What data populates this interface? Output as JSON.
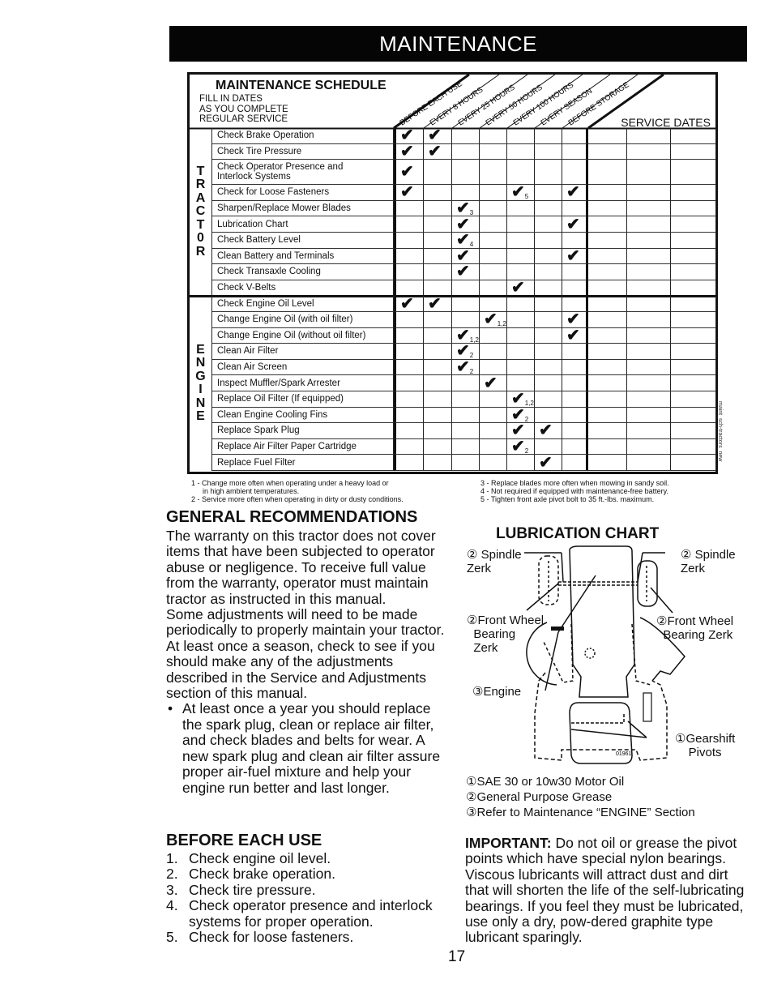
{
  "banner": {
    "title": "MAINTENANCE"
  },
  "schedule": {
    "title": "MAINTENANCE SCHEDULE",
    "subtitle_lines": [
      "FILL IN DATES",
      "AS YOU COMPLETE",
      "REGULAR SERVICE"
    ],
    "interval_headers": [
      "BEFORE EACH USE",
      "EVERY 8 HOURS",
      "EVERY 25 HOURS",
      "EVERY 50 HOURS",
      "EVERY 100 HOURS",
      "EVERY SEASON",
      "BEFORE STORAGE"
    ],
    "service_dates_label": "SERVICE DATES",
    "check_symbol": "✔",
    "sections": [
      {
        "name": "TRACTOR",
        "letters": [
          "T",
          "R",
          "A",
          "C",
          "T",
          "0",
          "R"
        ],
        "rows": [
          {
            "task": "Check Brake Operation",
            "checks": [
              {
                "col": 0,
                "note": ""
              },
              {
                "col": 1,
                "note": ""
              }
            ]
          },
          {
            "task": "Check Tire Pressure",
            "checks": [
              {
                "col": 0,
                "note": ""
              },
              {
                "col": 1,
                "note": ""
              }
            ]
          },
          {
            "task": "Check Operator Presence and\nInterlock Systems",
            "checks": [
              {
                "col": 0,
                "note": ""
              }
            ],
            "tall": true
          },
          {
            "task": "Check for Loose Fasteners",
            "checks": [
              {
                "col": 0,
                "note": ""
              },
              {
                "col": 4,
                "note": "5"
              },
              {
                "col": 6,
                "note": ""
              }
            ]
          },
          {
            "task": "Sharpen/Replace Mower Blades",
            "checks": [
              {
                "col": 2,
                "note": "3"
              }
            ]
          },
          {
            "task": "Lubrication Chart",
            "checks": [
              {
                "col": 2,
                "note": ""
              },
              {
                "col": 6,
                "note": ""
              }
            ]
          },
          {
            "task": "Check Battery Level",
            "checks": [
              {
                "col": 2,
                "note": "4"
              }
            ]
          },
          {
            "task": "Clean Battery and Terminals",
            "checks": [
              {
                "col": 2,
                "note": ""
              },
              {
                "col": 6,
                "note": ""
              }
            ]
          },
          {
            "task": "Check Transaxle Cooling",
            "checks": [
              {
                "col": 2,
                "note": ""
              }
            ]
          },
          {
            "task": "Check V-Belts",
            "checks": [
              {
                "col": 4,
                "note": ""
              }
            ]
          }
        ]
      },
      {
        "name": "ENGINE",
        "letters": [
          "E",
          "N",
          "G",
          "I",
          "N",
          "E"
        ],
        "rows": [
          {
            "task": "Check Engine Oil Level",
            "checks": [
              {
                "col": 0,
                "note": ""
              },
              {
                "col": 1,
                "note": ""
              }
            ]
          },
          {
            "task": "Change Engine Oil (with oil filter)",
            "checks": [
              {
                "col": 3,
                "note": "1,2"
              },
              {
                "col": 6,
                "note": ""
              }
            ]
          },
          {
            "task": "Change Engine Oil (without oil filter)",
            "checks": [
              {
                "col": 2,
                "note": "1,2"
              },
              {
                "col": 6,
                "note": ""
              }
            ]
          },
          {
            "task": "Clean Air Filter",
            "checks": [
              {
                "col": 2,
                "note": "2"
              }
            ]
          },
          {
            "task": "Clean Air Screen",
            "checks": [
              {
                "col": 2,
                "note": "2"
              }
            ]
          },
          {
            "task": "Inspect Muffler/Spark Arrester",
            "checks": [
              {
                "col": 3,
                "note": ""
              }
            ]
          },
          {
            "task": "Replace Oil Filter (If equipped)",
            "checks": [
              {
                "col": 4,
                "note": "1,2"
              }
            ]
          },
          {
            "task": "Clean Engine Cooling Fins",
            "checks": [
              {
                "col": 4,
                "note": "2"
              }
            ]
          },
          {
            "task": "Replace Spark Plug",
            "checks": [
              {
                "col": 4,
                "note": ""
              },
              {
                "col": 5,
                "note": ""
              }
            ]
          },
          {
            "task": "Replace Air Filter Paper Cartridge",
            "checks": [
              {
                "col": 4,
                "note": "2"
              }
            ]
          },
          {
            "task": "Replace Fuel Filter",
            "checks": [
              {
                "col": 5,
                "note": ""
              }
            ]
          }
        ]
      }
    ],
    "footnotes_left": [
      "1 - Change more often when operating under a heavy load or",
      "     in high ambient temperatures.",
      "2 - Service more often when operating in dirty or dusty conditions."
    ],
    "footnotes_right": [
      "3 - Replace blades more often when mowing in sandy soil.",
      "4 - Not required if equipped with maintenance-free battery.",
      "5 - Tighten front axle pivot bolt to 35 ft.-lbs. maximum."
    ],
    "side_note": "maint_sch-tractors_new"
  },
  "general": {
    "heading": "GENERAL RECOMMENDATIONS",
    "para1": "The warranty on this tractor does not cover items that have been subjected to operator abuse or negligence. To receive full value from the warranty, operator must maintain tractor as instructed in this manual.",
    "para2": "Some adjustments will need to be made periodically to properly maintain your tractor.",
    "para3": "At least once a season, check to see if you should make any of the adjustments described in the Service and Adjustments section of this manual.",
    "bullet_symbol": "•",
    "bullet": "At least once a year you should replace the spark plug, clean or replace air filter, and check blades and belts for wear. A new spark plug and clean air filter assure proper air-fuel mixture and help your engine run better and last longer."
  },
  "before_each_use": {
    "heading": "BEFORE EACH USE",
    "items": [
      {
        "num": "1.",
        "text": "Check engine oil level."
      },
      {
        "num": "2.",
        "text": "Check brake operation."
      },
      {
        "num": "3.",
        "text": "Check tire pressure."
      },
      {
        "num": "4.",
        "text": "Check operator presence and interlock systems for proper operation."
      },
      {
        "num": "5.",
        "text": "Check for loose fasteners."
      }
    ]
  },
  "lubrication": {
    "title": "LUBRICATION CHART",
    "labels": {
      "spindle_left": "② Spindle\nZerk",
      "spindle_right": "② Spindle\nZerk",
      "wheel_left": "②Front Wheel\n  Bearing\n  Zerk",
      "wheel_right": "②Front Wheel\n  Bearing Zerk",
      "engine": "③Engine",
      "gearshift": "①Gearshift\n    Pivots",
      "figure_code": "01961"
    },
    "legend": [
      "①SAE 30 or 10w30 Motor Oil",
      "②General Purpose Grease",
      "③Refer to Maintenance  “ENGINE” Section"
    ]
  },
  "important": {
    "label": "IMPORTANT:",
    "text": " Do not oil or grease the pivot points which have special nylon bearings. Viscous lubricants will attract dust and dirt that will shorten the life of the self-lubricating bearings. If you feel they must be lubricated, use only a dry, pow-dered graphite type lubricant sparingly."
  },
  "page_number": "17"
}
